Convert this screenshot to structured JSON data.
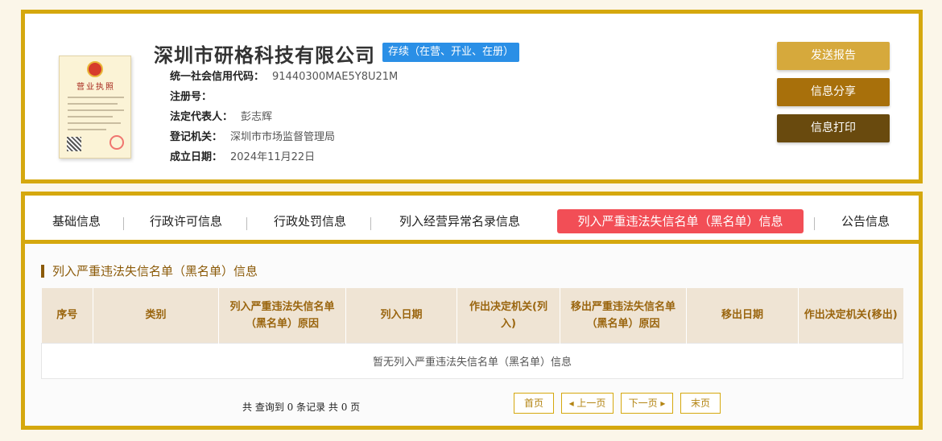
{
  "company": {
    "name": "深圳市研格科技有限公司",
    "status": "存续（在营、开业、在册）",
    "license_title": "营业执照",
    "fields": [
      {
        "label": "统一社会信用代码：",
        "value": "91440300MAE5Y8U21M"
      },
      {
        "label": "注册号：",
        "value": ""
      },
      {
        "label": "法定代表人：",
        "value": "彭志辉"
      },
      {
        "label": "登记机关：",
        "value": "深圳市市场监督管理局"
      },
      {
        "label": "成立日期：",
        "value": "2024年11月22日"
      }
    ]
  },
  "actions": {
    "send_report": "发送报告",
    "share": "信息分享",
    "print": "信息打印"
  },
  "tabs": [
    {
      "label": "基础信息"
    },
    {
      "label": "行政许可信息"
    },
    {
      "label": "行政处罚信息"
    },
    {
      "label": "列入经营异常名录信息"
    },
    {
      "label": "列入严重违法失信名单（黑名单）信息"
    },
    {
      "label": "公告信息"
    }
  ],
  "section": {
    "title": "列入严重违法失信名单（黑名单）信息",
    "columns": [
      "序号",
      "类别",
      "列入严重违法失信名单（黑名单）原因",
      "列入日期",
      "作出决定机关(列入)",
      "移出严重违法失信名单（黑名单）原因",
      "移出日期",
      "作出决定机关(移出)"
    ],
    "empty_text": "暂无列入严重违法失信名单（黑名单）信息"
  },
  "pagination": {
    "summary": "共 查询到 0 条记录 共 0 页",
    "first": "首页",
    "prev": "◂ 上一页",
    "next": "下一页 ▸",
    "last": "末页"
  },
  "colors": {
    "accent_gold": "#d5a80e",
    "active_tab": "#f24e56",
    "status_blue": "#2a8fe6"
  }
}
